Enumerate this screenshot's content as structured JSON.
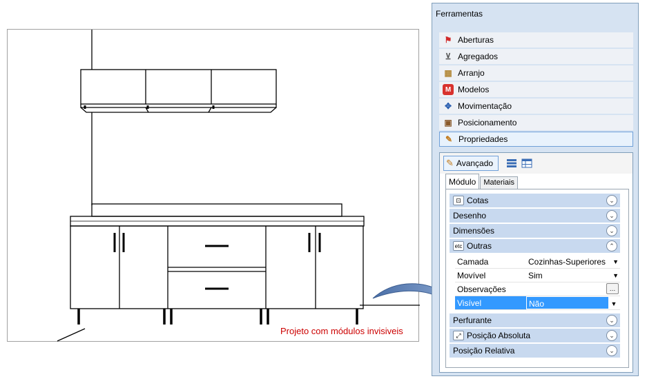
{
  "viewport": {
    "caption": "Projeto com módulos invisiveis"
  },
  "panel": {
    "title": "Ferramentas",
    "tools": [
      {
        "label": "Aberturas",
        "icon": "aberturas-icon"
      },
      {
        "label": "Agregados",
        "icon": "agregados-icon"
      },
      {
        "label": "Arranjo",
        "icon": "arranjo-icon"
      },
      {
        "label": "Modelos",
        "icon": "modelos-icon"
      },
      {
        "label": "Movimentação",
        "icon": "move-icon"
      },
      {
        "label": "Posicionamento",
        "icon": "posicionamento-icon"
      },
      {
        "label": "Propriedades",
        "icon": "propriedades-icon"
      }
    ],
    "toolbar": {
      "avancado_label": "Avançado"
    },
    "tabs": [
      "Módulo",
      "Materiais"
    ],
    "sections": {
      "cotas": "Cotas",
      "desenho": "Desenho",
      "dimensoes": "Dimensões",
      "outras": "Outras",
      "perfurante": "Perfurante",
      "posicao_absoluta": "Posição Absoluta",
      "posicao_relativa": "Posição Relativa"
    },
    "properties": {
      "camada": {
        "key": "Camada",
        "value": "Cozinhas-Superiores"
      },
      "movivel": {
        "key": "Movível",
        "value": "Sim"
      },
      "observacoes": {
        "key": "Observações",
        "value": ""
      },
      "visivel": {
        "key": "Visível",
        "value": "Não"
      }
    },
    "colors": {
      "accent": "#3399ff",
      "section": "#c8d9ef",
      "panel_bg": "#d6e3f2"
    }
  }
}
